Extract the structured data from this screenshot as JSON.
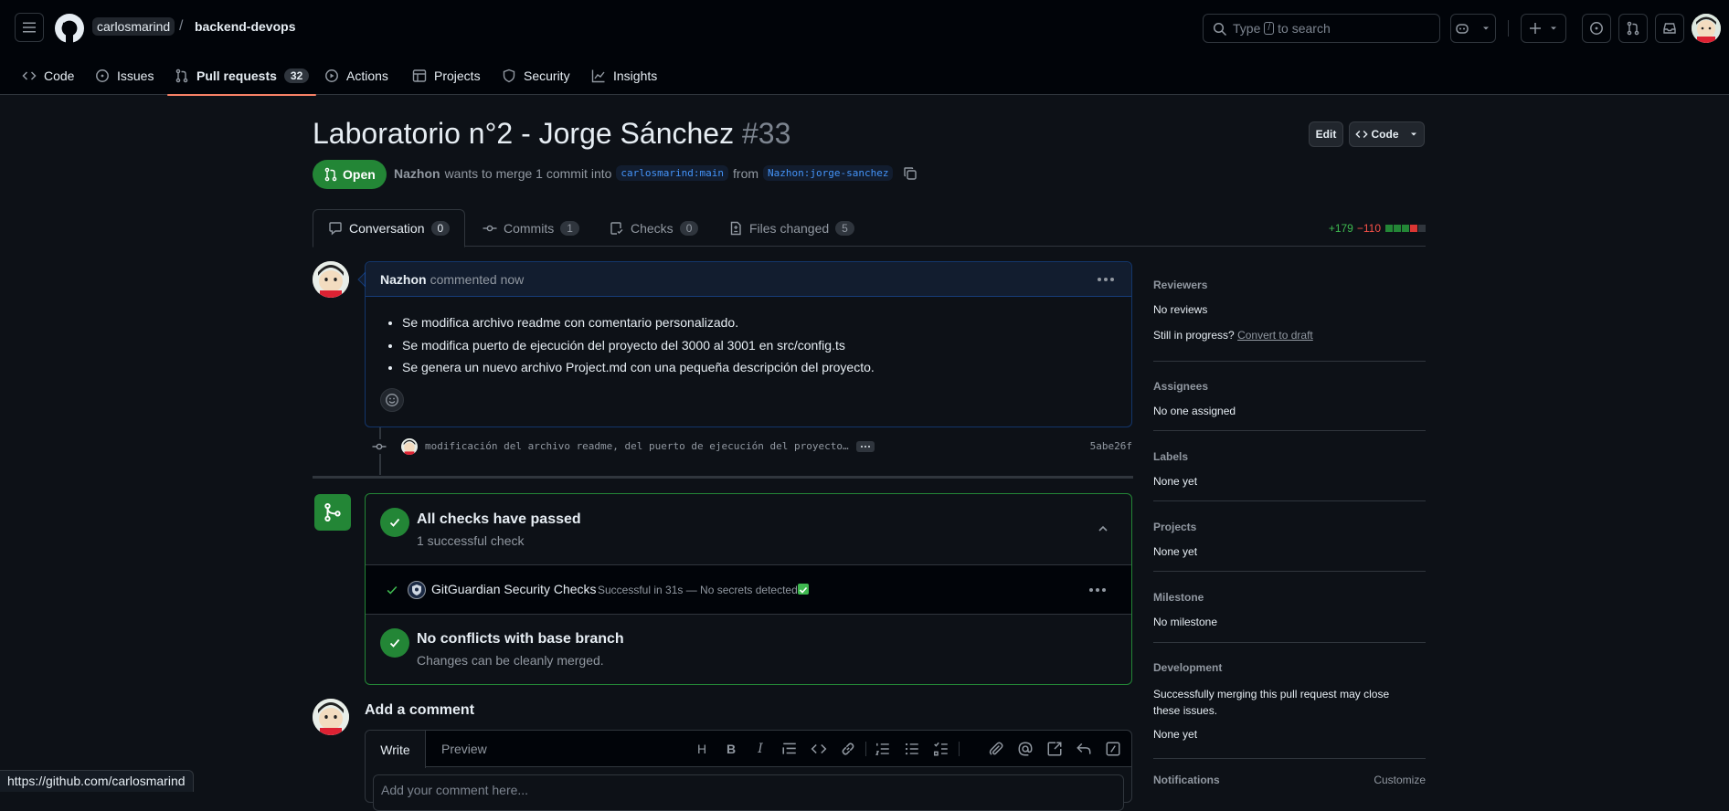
{
  "header": {
    "owner": "carlosmarind",
    "separator": "/",
    "repo": "backend-devops",
    "search_prefix": "Type",
    "search_key": "/",
    "search_suffix": "to search"
  },
  "repo_nav": [
    {
      "label": "Code"
    },
    {
      "label": "Issues"
    },
    {
      "label": "Pull requests",
      "count": "32"
    },
    {
      "label": "Actions"
    },
    {
      "label": "Projects"
    },
    {
      "label": "Security"
    },
    {
      "label": "Insights"
    }
  ],
  "pr": {
    "title": "Laboratorio n°2 - Jorge Sánchez",
    "number": "#33",
    "edit_label": "Edit",
    "code_label": "Code",
    "state": "Open",
    "author": "Nazhon",
    "merge_text": "wants to merge 1 commit into",
    "base_branch": "carlosmarind:main",
    "from_text": "from",
    "head_branch": "Nazhon:jorge-sanchez"
  },
  "tabs": [
    {
      "label": "Conversation",
      "count": "0"
    },
    {
      "label": "Commits",
      "count": "1"
    },
    {
      "label": "Checks",
      "count": "0"
    },
    {
      "label": "Files changed",
      "count": "5"
    }
  ],
  "diffstat": {
    "additions": "+179",
    "deletions": "−110"
  },
  "colors": {
    "green": "#238636",
    "accent": "#f78166",
    "blue": "#4493f8"
  },
  "comment": {
    "author": "Nazhon",
    "action": "commented now",
    "bullets": [
      "Se modifica archivo readme con comentario personalizado.",
      "Se modifica puerto de ejecución del proyecto del 3000 al 3001 en src/config.ts",
      "Se genera un nuevo archivo Project.md con una pequeña descripción del proyecto."
    ]
  },
  "commit": {
    "message": "modificación del archivo readme, del puerto de ejecución del proyecto…",
    "sha": "5abe26f"
  },
  "merge": {
    "checks_title": "All checks have passed",
    "checks_sub": "1 successful check",
    "check_name": "GitGuardian Security Checks",
    "check_status": "Successful in 31s — No secrets detected",
    "conflicts_title": "No conflicts with base branch",
    "conflicts_sub": "Changes can be cleanly merged."
  },
  "add_comment": {
    "title": "Add a comment",
    "write": "Write",
    "preview": "Preview",
    "placeholder": "Add your comment here..."
  },
  "sidebar": {
    "reviewers_h": "Reviewers",
    "reviewers_v": "No reviews",
    "in_progress": "Still in progress?",
    "convert_draft": "Convert to draft",
    "assignees_h": "Assignees",
    "assignees_v": "No one assigned",
    "labels_h": "Labels",
    "labels_v": "None yet",
    "projects_h": "Projects",
    "projects_v": "None yet",
    "milestone_h": "Milestone",
    "milestone_v": "No milestone",
    "development_h": "Development",
    "development_text": "Successfully merging this pull request may close these issues.",
    "development_v": "None yet",
    "notifications_h": "Notifications",
    "customize": "Customize"
  },
  "status_url": "https://github.com/carlosmarind"
}
